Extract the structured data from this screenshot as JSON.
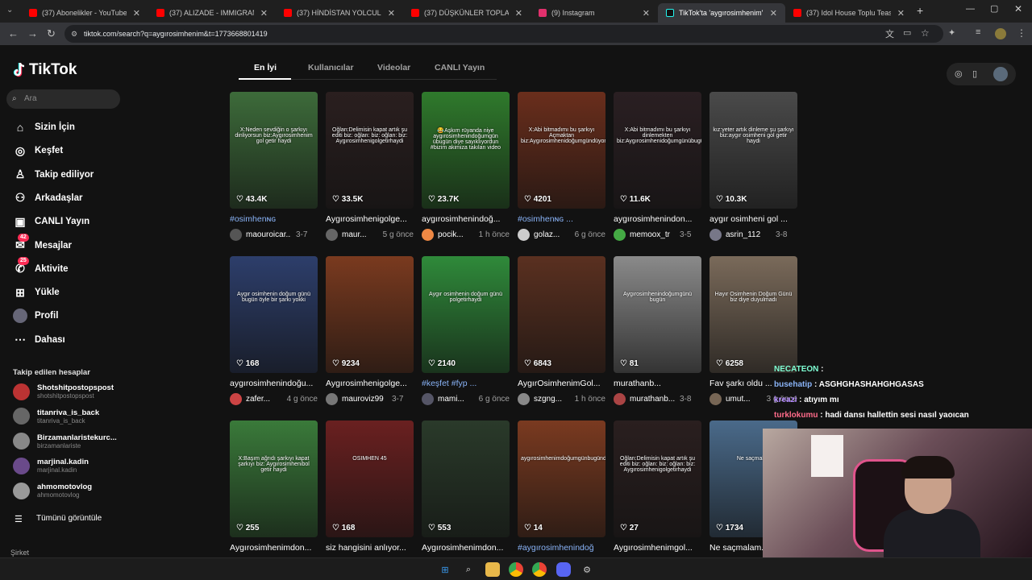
{
  "browser": {
    "tabs": [
      {
        "title": "(37) Abonelikler - YouTube",
        "favicon": "youtube-icon",
        "color": "#ff0000"
      },
      {
        "title": "(37) ALIZADE - IMMIGRANT (Offic",
        "favicon": "youtube-icon",
        "color": "#ff0000"
      },
      {
        "title": "(37) HİNDİSTAN YOLCULUĞU v",
        "favicon": "youtube-icon",
        "color": "#ff0000"
      },
      {
        "title": "(37) DÜŞKÜNLER TOPLANTISI",
        "favicon": "youtube-icon",
        "color": "#ff0000"
      },
      {
        "title": "(9) Instagram",
        "favicon": "instagram-icon",
        "color": "#e1306c"
      },
      {
        "title": "TikTok'ta 'aygırosimhenim' bul",
        "favicon": "tiktok-icon",
        "color": "#000000"
      },
      {
        "title": "(37) Idol House Toplu Teaser Ç",
        "favicon": "youtube-icon",
        "color": "#ff0000"
      }
    ],
    "url": "tiktok.com/search?q=aygırosimhenim&t=1773668801419"
  },
  "app": {
    "logo": "TikTok",
    "search_placeholder": "Ara",
    "nav": [
      {
        "label": "Sizin İçin",
        "icon": "home-icon"
      },
      {
        "label": "Keşfet",
        "icon": "compass-icon"
      },
      {
        "label": "Takip ediliyor",
        "icon": "following-icon"
      },
      {
        "label": "Arkadaşlar",
        "icon": "friends-icon"
      },
      {
        "label": "CANLI Yayın",
        "icon": "live-icon"
      },
      {
        "label": "Mesajlar",
        "icon": "messages-icon",
        "badge": "42"
      },
      {
        "label": "Aktivite",
        "icon": "activity-icon",
        "badge": "25"
      },
      {
        "label": "Yükle",
        "icon": "upload-icon"
      },
      {
        "label": "Profil",
        "icon": "profile-icon"
      },
      {
        "label": "Dahası",
        "icon": "more-icon"
      }
    ],
    "following_header": "Takip edilen hesaplar",
    "following": [
      {
        "name": "Shotshitpostopspost",
        "handle": "shotshitpostopspost"
      },
      {
        "name": "titanriva_is_back",
        "handle": "titanriva_is_back"
      },
      {
        "name": "Birzamanlaristekurc...",
        "handle": "birzamanlariste"
      },
      {
        "name": "marjinal.kadin",
        "handle": "marjinal.kadin"
      },
      {
        "name": "ahmomotovlog",
        "handle": "ahmomotovlog"
      }
    ],
    "see_all": "Tümünü görüntüle",
    "footer_partial": "Şirket",
    "search_tabs": [
      "En İyi",
      "Kullanıcılar",
      "Videolar",
      "CANLI Yayın"
    ]
  },
  "videos": [
    {
      "likes": "43.4K",
      "title": "#osimhenɴɢ",
      "user": "maouroicar...",
      "date": "3-7",
      "caption": "X:Neden sevdiğin o şarkıyı dinliyorsun biz:Aygırosimhenim gol getir haydi",
      "tag": true,
      "bg": "#3d6b3a"
    },
    {
      "likes": "33.5K",
      "title": "Aygırosimhenigolge...",
      "user": "maur...",
      "date": "5 g önce",
      "caption": "Oğlan:Delimisin kapat artık şu editi biz: oğlan: biz: oğlan: biz: Aygırosimhenigolgetirhaydi",
      "tag": false,
      "bg": "#2a1f1f"
    },
    {
      "likes": "23.7K",
      "title": "aygırosimhenindoğ...",
      "user": "pocik...",
      "date": "1 h önce",
      "caption": "😂Aşkım rüyanda niye aygırosimhenindoğumgün übugün diye sayıklıyordun #bizim akimiza takılan video",
      "tag": false,
      "bg": "#2f7a2c"
    },
    {
      "likes": "4201",
      "title": "#osimhenɴɢ ...",
      "user": "golaz...",
      "date": "6 g önce",
      "caption": "X:Abi bitmadımı bu şarkıyı Açmaktan biz:Aygırosimhenidoğumgündüyordhaydi",
      "tag": true,
      "bg": "#6a2e1c"
    },
    {
      "likes": "11.6K",
      "title": "aygırosimhenindon...",
      "user": "memoox_tr",
      "date": "3-5",
      "caption": "X:Abi bitmadımı bu şarkıyı dinlemekten biz:Aygırosimhenidoğumgünübugünyürhaydi",
      "tag": false,
      "bg": "#2a1f22"
    },
    {
      "likes": "10.3K",
      "title": "aygır osimheni gol ...",
      "user": "asrin_112",
      "date": "3-8",
      "caption": "kız:yeter artık dinleme şu şarkıyı biz:aygır osimheni gol getir haydi",
      "tag": false,
      "bg": "#4a4a4a"
    },
    {
      "likes": "168",
      "title": "aygırosimhenindoğu...",
      "user": "zafer...",
      "date": "4 g önce",
      "caption": "Aygır osimhenin doğum günü bugün öyle bir şarkı yokki",
      "tag": false,
      "bg": "#2d3e6b"
    },
    {
      "likes": "9234",
      "title": "Aygırosimhenigolge...",
      "user": "mauroviz99",
      "date": "3-7",
      "caption": "",
      "tag": false,
      "bg": "#7a3a1f"
    },
    {
      "likes": "2140",
      "title": "#keşfet #fyp ...",
      "user": "mami...",
      "date": "6 g önce",
      "caption": "Aygır osimhenin doğum günü polgetirhaydi",
      "tag": true,
      "bg": "#2f8a3a"
    },
    {
      "likes": "6843",
      "title": "AygırOsimhenimGol...",
      "user": "szgng...",
      "date": "1 h önce",
      "caption": "",
      "tag": false,
      "bg": "#5a3020"
    },
    {
      "likes": "81",
      "title": "murathanb...",
      "user": "murathanb...",
      "date": "3-8",
      "caption": "Aygırosimhenindoğumgünü bugün",
      "tag": false,
      "bg": "#8a8a8a"
    },
    {
      "likes": "6258",
      "title": "Fav şarkı oldu ...",
      "user": "umut...",
      "date": "3 g önce",
      "caption": "Hayır Osimhenin Doğum Günü biz diye duyulmadı",
      "tag": false,
      "bg": "#7a6a5a"
    },
    {
      "likes": "255",
      "title": "Aygırosimhenimdon...",
      "user": "",
      "date": "",
      "caption": "X:Başım ağrıdı şarkıyı kapat şarkıyı biz: Aygırosimhenibol getir haydi",
      "tag": false,
      "bg": "#3a7a3a"
    },
    {
      "likes": "168",
      "title": "siz hangisini anlıyor...",
      "user": "",
      "date": "",
      "caption": "OSIMHEN 45",
      "tag": false,
      "bg": "#6a2020"
    },
    {
      "likes": "553",
      "title": "Aygırosimhenimdon...",
      "user": "",
      "date": "",
      "caption": "",
      "tag": false,
      "bg": "#2a3a2a"
    },
    {
      "likes": "14",
      "title": "#aygırosimhenindoğ",
      "user": "",
      "date": "",
      "caption": "aygırosimhenimdoğumgünbugündüyordhaydi",
      "tag": true,
      "bg": "#7a3a20"
    },
    {
      "likes": "27",
      "title": "Aygırosimhenimgol...",
      "user": "",
      "date": "",
      "caption": "Oğlan:Delimisin kapat artık şu editi biz: oğlan: biz: oğlan: biz: Aygırosimhenigolgetirhaydi",
      "tag": false,
      "bg": "#2a1f1f"
    },
    {
      "likes": "1734",
      "title": "Ne saçmalam...",
      "user": "",
      "date": "",
      "caption": "Ne saçmaları",
      "tag": false,
      "bg": "#4a6a8a"
    }
  ],
  "chat": [
    {
      "user": "NECATEON",
      "text": "",
      "color": "#7fffd4"
    },
    {
      "user": "busehatip",
      "text": "ASGHGHASHAHGHGASAS",
      "color": "#8ab4f8"
    },
    {
      "user": "kreazi",
      "text": "atıyım mı",
      "color": "#b388ff"
    },
    {
      "user": "turklokumu",
      "text": "hadi dansı hallettin sesi nasıl yaoıcan",
      "color": "#ff6b8a"
    }
  ]
}
